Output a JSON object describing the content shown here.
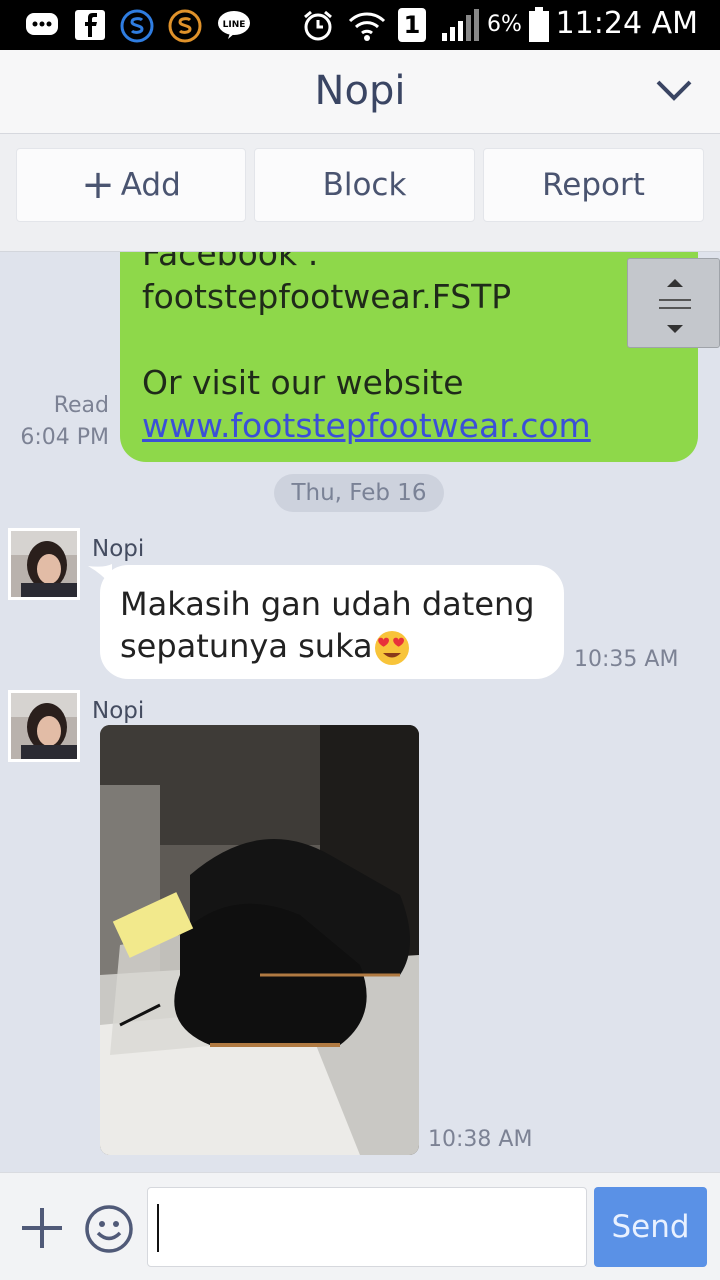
{
  "status_bar": {
    "time": "11:24 AM",
    "battery_percent": "6%",
    "sim_badge": "1",
    "line_icon_text": "LINE"
  },
  "header": {
    "title": "Nopi"
  },
  "actions": {
    "add_label": "Add",
    "block_label": "Block",
    "report_label": "Report"
  },
  "messages": {
    "outgoing": {
      "line1": "Facebook :",
      "line2": "footstepfootwear.FSTP",
      "line3": "Or visit our website",
      "link": "www.footstepfootwear.com",
      "read_label": "Read",
      "time": "6:04 PM"
    },
    "date_separator": "Thu, Feb 16",
    "incoming_text": {
      "sender": "Nopi",
      "line1": "Makasih gan udah dateng",
      "line2": "sepatunya suka",
      "emoji": "heart-eyes-emoji",
      "time": "10:35 AM"
    },
    "incoming_photo": {
      "sender": "Nopi",
      "time": "10:38 AM"
    }
  },
  "composer": {
    "send_label": "Send",
    "input_value": ""
  },
  "colors": {
    "outgoing_bubble": "#8ed84a",
    "chat_background": "#dfe3ec",
    "send_button": "#5a91e6",
    "header_text": "#3a4563"
  }
}
